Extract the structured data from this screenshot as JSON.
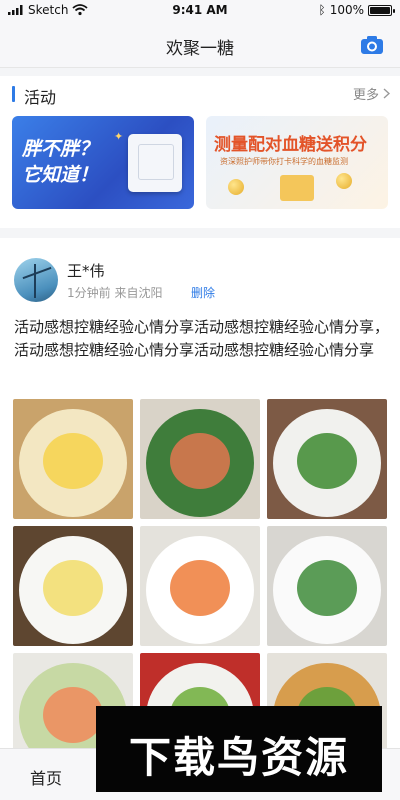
{
  "status": {
    "carrier": "Sketch",
    "time": "9:41 AM",
    "battery": "100%",
    "battery_level": 1.0
  },
  "nav": {
    "title": "欢聚一糖",
    "camera_icon": "camera-icon"
  },
  "activity": {
    "title": "活动",
    "more": "更多",
    "banners": [
      {
        "title_line1": "胖不胖？",
        "title_line2": "它知道！"
      },
      {
        "title": "测量配对血糖送积分",
        "subtitle": "资深照护师带你打卡科学的血糖监测"
      }
    ]
  },
  "post": {
    "user_name": "王*伟",
    "time_ago": "1分钟前",
    "location": "来自沈阳",
    "delete_label": "删除",
    "text": "活动感想控糖经验心情分享活动感想控糖经验心情分享，活动感想控糖经验心情分享活动感想控糖经验心情分享",
    "photos": [
      {
        "name": "grilled-sandwich-photo",
        "bg": "#c9a36b",
        "plate": "#f3e7c2",
        "accent": "#f6d24b"
      },
      {
        "name": "salmon-salad-photo",
        "bg": "#d9d3c8",
        "plate": "#3f7d3b",
        "accent": "#e07650"
      },
      {
        "name": "stirfry-plate-photo",
        "bg": "#7d5a45",
        "plate": "#f1f1ee",
        "accent": "#3d8a2f"
      },
      {
        "name": "egg-avocado-salad-photo",
        "bg": "#5e4630",
        "plate": "#f7f7f4",
        "accent": "#f2dd6a"
      },
      {
        "name": "shrimp-pasta-photo",
        "bg": "#e4e2dc",
        "plate": "#ffffff",
        "accent": "#ee7c3a"
      },
      {
        "name": "salmon-broccoli-photo",
        "bg": "#d8d6d1",
        "plate": "#fafafa",
        "accent": "#3e8b3a"
      },
      {
        "name": "shrimp-avocado-photo",
        "bg": "#e9e8e3",
        "plate": "#c7d9a4",
        "accent": "#f08a5c"
      },
      {
        "name": "fresh-salad-photo",
        "bg": "#bf2f2a",
        "plate": "#f2f2ee",
        "accent": "#6fae3a"
      },
      {
        "name": "grain-bowl-photo",
        "bg": "#e5e2db",
        "plate": "#d79d4d",
        "accent": "#5ba13a"
      }
    ]
  },
  "tabbar": {
    "home_label": "首页"
  },
  "watermark": {
    "text": "下载鸟资源"
  }
}
